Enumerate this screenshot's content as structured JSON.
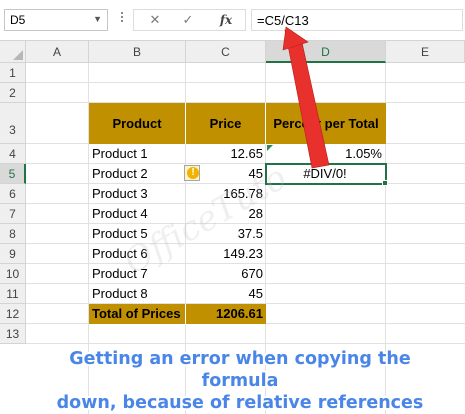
{
  "formula_bar": {
    "name_box": "D5",
    "cancel_icon": "✕",
    "enter_icon": "✓",
    "fx_label": "fx",
    "formula": "=C5/C13"
  },
  "columns": [
    "A",
    "B",
    "C",
    "D",
    "E"
  ],
  "selected_column": "D",
  "rows": [
    "1",
    "2",
    "3",
    "4",
    "5",
    "6",
    "7",
    "8",
    "9",
    "10",
    "11",
    "12",
    "13"
  ],
  "selected_row": "5",
  "table": {
    "headers": {
      "product": "Product",
      "price": "Price",
      "percent": "Percent per Total"
    },
    "items": [
      {
        "product": "Product 1",
        "price": "12.65",
        "percent": "1.05%"
      },
      {
        "product": "Product 2",
        "price": "45",
        "percent": "#DIV/0!"
      },
      {
        "product": "Product 3",
        "price": "165.78",
        "percent": ""
      },
      {
        "product": "Product 4",
        "price": "28",
        "percent": ""
      },
      {
        "product": "Product 5",
        "price": "37.5",
        "percent": ""
      },
      {
        "product": "Product 6",
        "price": "149.23",
        "percent": ""
      },
      {
        "product": "Product 7",
        "price": "670",
        "percent": ""
      },
      {
        "product": "Product 8",
        "price": "45",
        "percent": ""
      }
    ],
    "total": {
      "label": "Total of Prices",
      "value": "1206.61"
    }
  },
  "error_indicator": "!",
  "watermark": "OfficeTuto",
  "caption": {
    "line1": "Getting an error when copying the formula",
    "line2": "down, because of relative references"
  },
  "colors": {
    "header_fill": "#c09000",
    "selection": "#217346",
    "arrow": "#e8312d",
    "caption_text": "#4a86e8"
  }
}
